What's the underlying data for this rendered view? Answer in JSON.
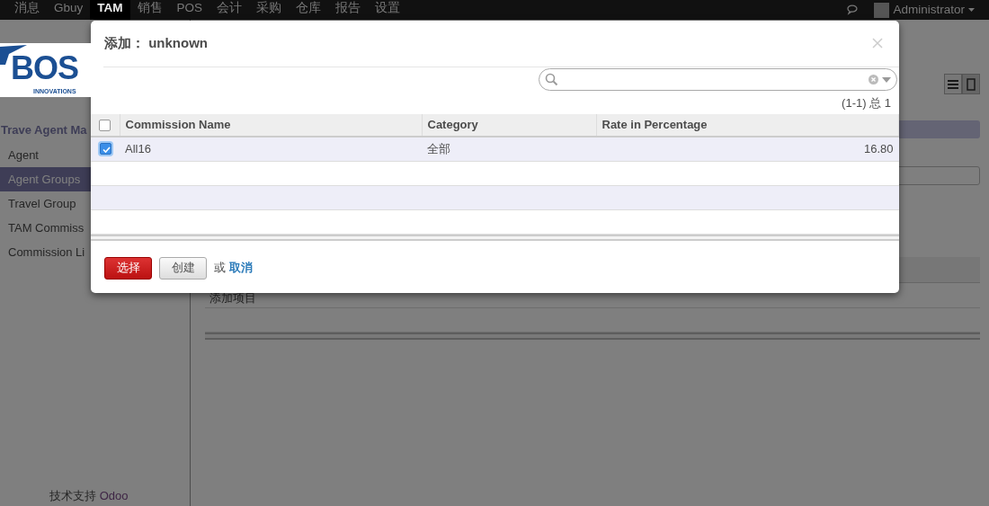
{
  "topbar": {
    "menus": [
      {
        "label": "消息",
        "selected": false
      },
      {
        "label": "Gbuy",
        "selected": false
      },
      {
        "label": "TAM",
        "selected": true
      },
      {
        "label": "销售",
        "selected": false
      },
      {
        "label": "POS",
        "selected": false
      },
      {
        "label": "会计",
        "selected": false
      },
      {
        "label": "采购",
        "selected": false
      },
      {
        "label": "仓库",
        "selected": false
      },
      {
        "label": "报告",
        "selected": false
      },
      {
        "label": "设置",
        "selected": false
      }
    ],
    "user": "Administrator"
  },
  "logo": {
    "text": "BOS",
    "tagline": "INNOVATIONS"
  },
  "sidebar": {
    "section": "Trave Agent Ma",
    "items": [
      {
        "label": "Agent",
        "selected": false
      },
      {
        "label": "Agent Groups",
        "selected": true
      },
      {
        "label": "Travel Group",
        "selected": false
      },
      {
        "label": "TAM Commiss",
        "selected": false
      },
      {
        "label": "Commission Li",
        "selected": false
      }
    ],
    "footer_label": "技术支持",
    "footer_link": "Odoo"
  },
  "background": {
    "add_item": "添加项目"
  },
  "dialog": {
    "title_label": "添加：",
    "title_value": "unknown",
    "pager": "(1-1) 总 1",
    "select_all": {
      "checked": false
    },
    "columns": [
      "Commission Name",
      "Category",
      "Rate in Percentage"
    ],
    "rows": [
      {
        "name": "All16",
        "category": "全部",
        "rate": "16.80",
        "checked": true
      }
    ],
    "buttons": {
      "select": "选择",
      "create": "创建",
      "or": "或",
      "cancel": "取消"
    }
  }
}
